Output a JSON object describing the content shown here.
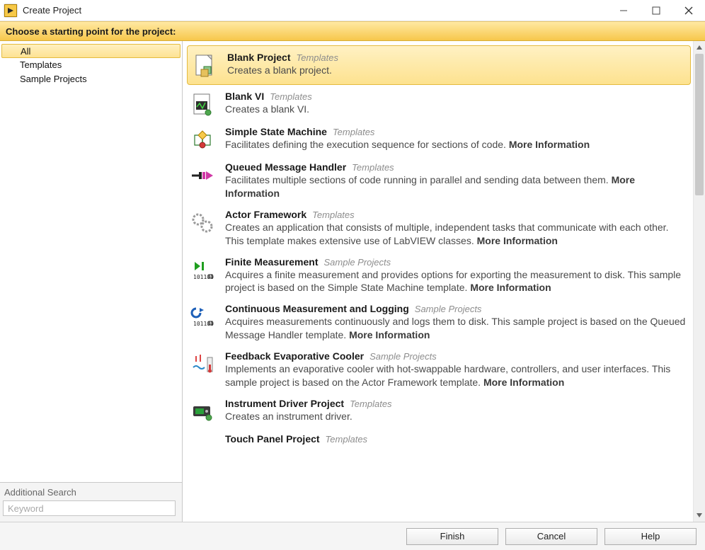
{
  "window": {
    "title": "Create Project"
  },
  "instruction": "Choose a starting point for the project:",
  "sidebar": {
    "items": [
      {
        "label": "All",
        "selected": true
      },
      {
        "label": "Templates",
        "selected": false
      },
      {
        "label": "Sample Projects",
        "selected": false
      }
    ],
    "additional_search_label": "Additional Search",
    "search_placeholder": "Keyword"
  },
  "entries": [
    {
      "title": "Blank Project",
      "category": "Templates",
      "desc": "Creates a blank project.",
      "more": false,
      "selected": true
    },
    {
      "title": "Blank VI",
      "category": "Templates",
      "desc": "Creates a blank VI.",
      "more": false,
      "selected": false
    },
    {
      "title": "Simple State Machine",
      "category": "Templates",
      "desc": "Facilitates defining the execution sequence for sections of code.",
      "more": true,
      "selected": false
    },
    {
      "title": "Queued Message Handler",
      "category": "Templates",
      "desc": "Facilitates multiple sections of code running in parallel and sending data between them.",
      "more": true,
      "selected": false
    },
    {
      "title": "Actor Framework",
      "category": "Templates",
      "desc": "Creates an application that consists of multiple, independent tasks that communicate with each other. This template makes extensive use of LabVIEW classes.",
      "more": true,
      "selected": false
    },
    {
      "title": "Finite Measurement",
      "category": "Sample Projects",
      "desc": "Acquires a finite measurement and provides options for exporting the measurement to disk. This sample project is based on the Simple State Machine template.",
      "more": true,
      "selected": false
    },
    {
      "title": "Continuous Measurement and Logging",
      "category": "Sample Projects",
      "desc": "Acquires measurements continuously and logs them to disk. This sample project is based on the Queued Message Handler template.",
      "more": true,
      "selected": false
    },
    {
      "title": "Feedback Evaporative Cooler",
      "category": "Sample Projects",
      "desc": "Implements an evaporative cooler with hot-swappable hardware, controllers, and user interfaces. This sample project is based on the Actor Framework template.",
      "more": true,
      "selected": false
    },
    {
      "title": "Instrument Driver Project",
      "category": "Templates",
      "desc": "Creates an instrument driver.",
      "more": false,
      "selected": false
    },
    {
      "title": "Touch Panel Project",
      "category": "Templates",
      "desc": "",
      "more": false,
      "selected": false
    }
  ],
  "more_label": "More Information",
  "footer": {
    "finish": "Finish",
    "cancel": "Cancel",
    "help": "Help"
  }
}
